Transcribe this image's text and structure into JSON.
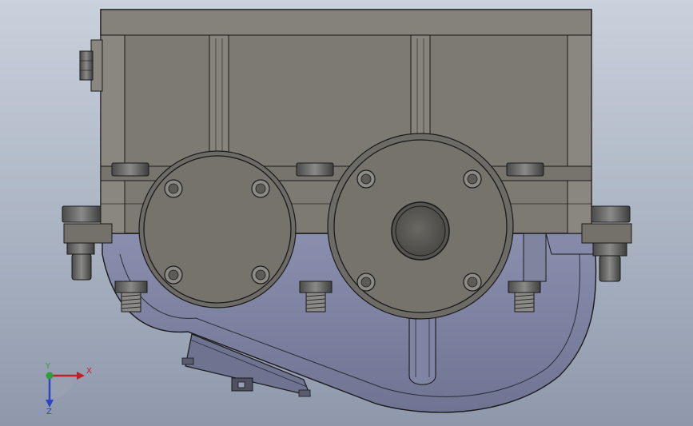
{
  "view": {
    "colors": {
      "background_top": "#c9d1dc",
      "background_bottom": "#8f98ab",
      "housing_upper": "#7d7a73",
      "housing_lower": "#7d82a0",
      "outline": "#1a1a1a",
      "cover": "#76736d",
      "boss": "#5e5c57"
    }
  },
  "triad": {
    "x_label": "X",
    "y_label": "Y",
    "z_label": "Z",
    "x_color": "#c0202a",
    "y_color": "#2e9e3a",
    "z_color": "#2a46c0"
  }
}
